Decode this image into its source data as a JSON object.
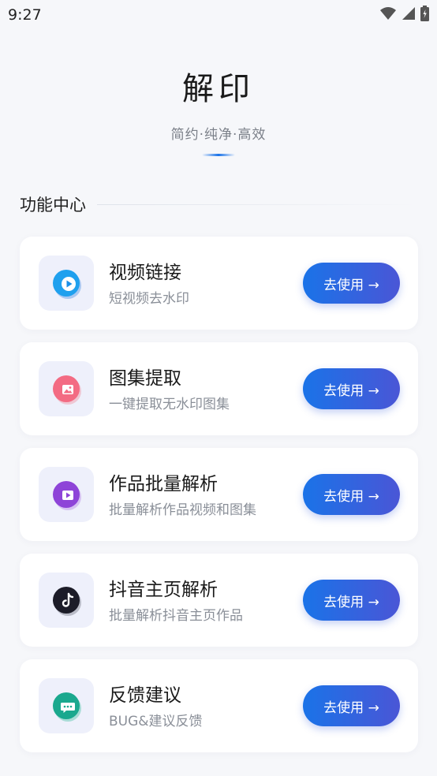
{
  "status_bar": {
    "time": "9:27"
  },
  "header": {
    "title": "解印",
    "slogan": "简约·纯净·高效"
  },
  "section": {
    "title": "功能中心"
  },
  "cards": [
    {
      "title": "视频链接",
      "subtitle": "短视频去水印",
      "button": "去使用 →",
      "icon": "play-icon",
      "accent": "#1a8fe8"
    },
    {
      "title": "图集提取",
      "subtitle": "一键提取无水印图集",
      "button": "去使用 →",
      "icon": "image-icon",
      "accent": "#f0607a"
    },
    {
      "title": "作品批量解析",
      "subtitle": "批量解析作品视频和图集",
      "button": "去使用 →",
      "icon": "video-icon",
      "accent": "#8e44d8"
    },
    {
      "title": "抖音主页解析",
      "subtitle": "批量解析抖音主页作品",
      "button": "去使用 →",
      "icon": "tiktok-icon",
      "accent": "#1c1c28"
    },
    {
      "title": "反馈建议",
      "subtitle": "BUG&建议反馈",
      "button": "去使用 →",
      "icon": "chat-icon",
      "accent": "#1aa88e"
    }
  ]
}
